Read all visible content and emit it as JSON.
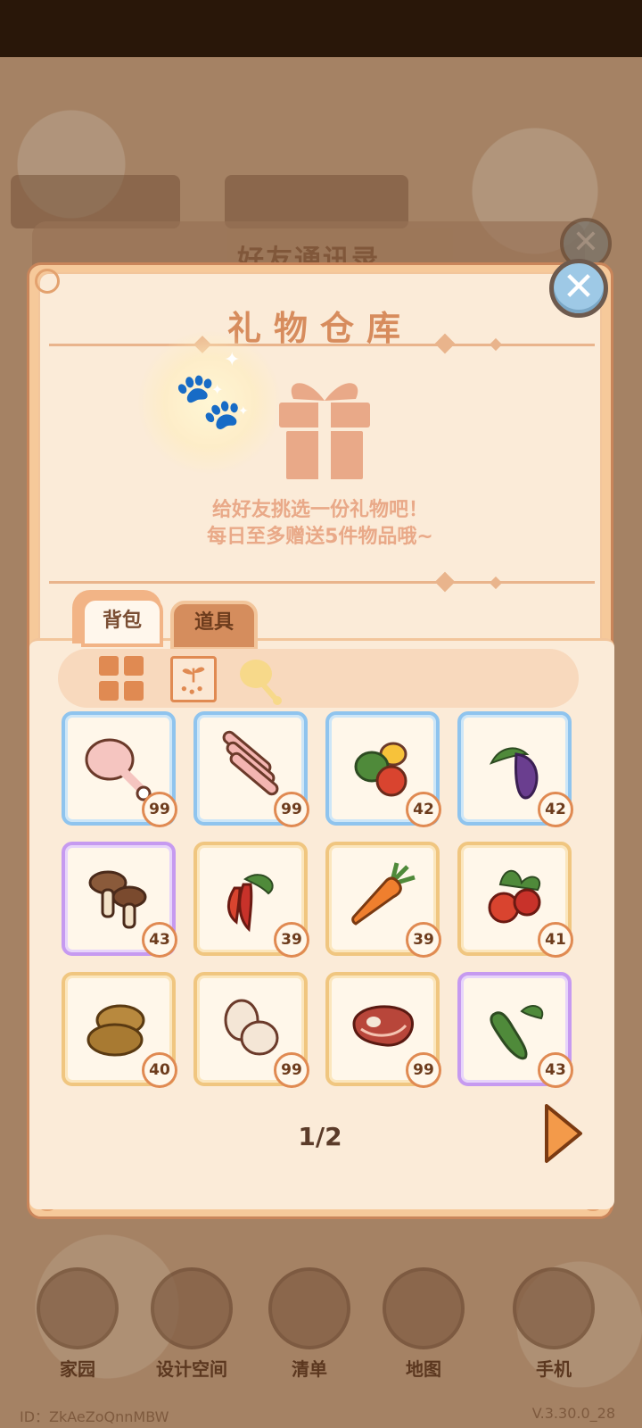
{
  "background": {
    "window_title": "好友通讯录",
    "nav": [
      {
        "label": "家园",
        "icon": "home-icon"
      },
      {
        "label": "设计空间",
        "icon": "design-icon"
      },
      {
        "label": "清单",
        "icon": "list-icon"
      },
      {
        "label": "地图",
        "icon": "map-pin-icon"
      },
      {
        "label": "手机",
        "icon": "phone-icon"
      }
    ],
    "user_id": "ID：ZkAeZoQnnMBW",
    "version": "V.3.30.0_28"
  },
  "dialog": {
    "title": "礼物仓库",
    "hint_line1": "给好友挑选一份礼物吧！",
    "hint_line2": "每日至多赠送5件物品哦~",
    "tabs": [
      {
        "label": "背包",
        "active": true
      },
      {
        "label": "道具",
        "active": false
      }
    ],
    "filters": [
      {
        "icon": "grid-all-icon",
        "active": true
      },
      {
        "icon": "seed-icon",
        "active": false
      },
      {
        "icon": "drumstick-icon",
        "active": false
      }
    ],
    "items": [
      {
        "name": "chicken-leg",
        "count": "99",
        "rarity": "blue"
      },
      {
        "name": "ribs",
        "count": "99",
        "rarity": "blue"
      },
      {
        "name": "peppers",
        "count": "42",
        "rarity": "blue"
      },
      {
        "name": "eggplant",
        "count": "42",
        "rarity": "blue"
      },
      {
        "name": "mushrooms",
        "count": "43",
        "rarity": "purple"
      },
      {
        "name": "chili",
        "count": "39",
        "rarity": "gold"
      },
      {
        "name": "carrot",
        "count": "39",
        "rarity": "gold"
      },
      {
        "name": "tomato",
        "count": "41",
        "rarity": "gold"
      },
      {
        "name": "potato",
        "count": "40",
        "rarity": "gold"
      },
      {
        "name": "eggs",
        "count": "99",
        "rarity": "gold"
      },
      {
        "name": "steak",
        "count": "99",
        "rarity": "gold"
      },
      {
        "name": "cucumber",
        "count": "43",
        "rarity": "purple"
      }
    ],
    "page": "1/2"
  },
  "colors": {
    "panel": "#fbebd8",
    "accent": "#e08a52",
    "title": "#d78c5d"
  }
}
